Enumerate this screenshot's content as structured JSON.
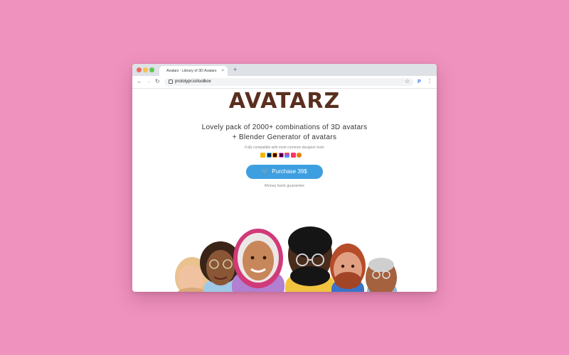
{
  "browser": {
    "tab_title": "Avatarz - Library of 3D Avatars",
    "tab_close": "×",
    "new_tab": "+",
    "url": "prototypr.io/toolbox",
    "back_glyph": "←",
    "forward_glyph": "→",
    "reload_glyph": "↻",
    "bookmark_glyph": "☆",
    "extension_glyph": "P",
    "menu_glyph": "⋮",
    "colors": {
      "close": "#ed6a5e",
      "minimize": "#f5bf4f",
      "maximize": "#61c554",
      "tabbar": "#dee1e6"
    }
  },
  "page": {
    "logo": "AVATARZ",
    "headline_line1": "Lovely pack of 2000+ combinations of 3D avatars",
    "headline_line2": "+ Blender Generator of avatars",
    "compatibility": "Fully compatible with most common designer tools",
    "tool_icons": [
      "sketch-icon",
      "photoshop-icon",
      "illustrator-icon",
      "xd-icon",
      "figma-icon",
      "invision-icon",
      "blender-icon"
    ],
    "purchase_label": "Purchase 39$",
    "guarantee": "Money back guarantee",
    "cart_glyph": "🛒",
    "colors": {
      "logo": "#5a2e1e",
      "button": "#3d9fe0",
      "background": "#ef92bd"
    }
  },
  "avatars": [
    "avatar-blonde-girl",
    "avatar-curly-glasses",
    "avatar-hijab-woman",
    "avatar-bearded-man-glasses",
    "avatar-red-bearded-man",
    "avatar-older-man-glasses"
  ]
}
